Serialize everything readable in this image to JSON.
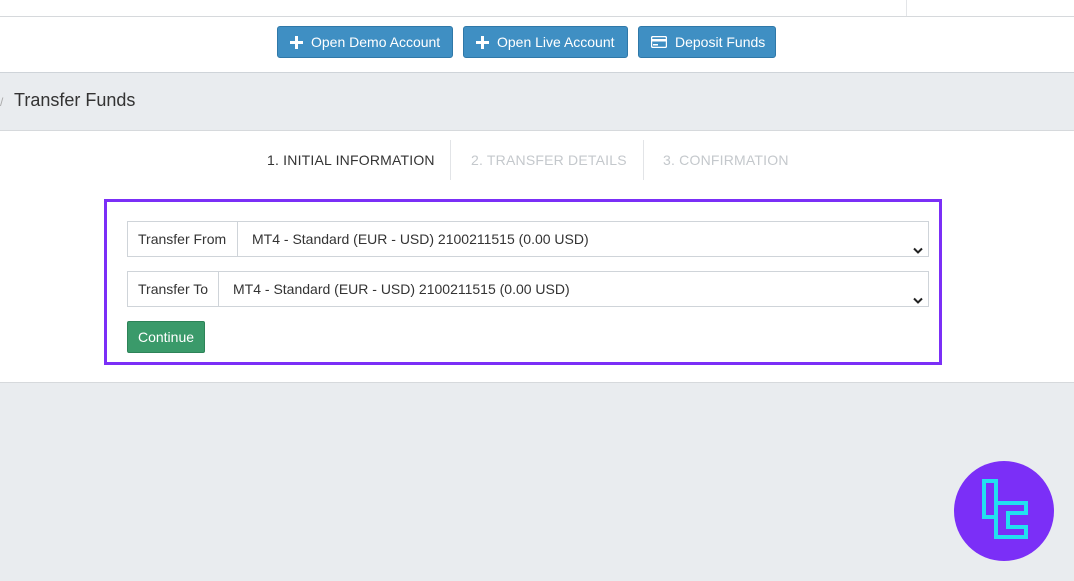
{
  "header_buttons": {
    "open_demo": "Open Demo Account",
    "open_live": "Open Live Account",
    "deposit": "Deposit Funds"
  },
  "breadcrumb": {
    "separator": "/"
  },
  "page": {
    "title": "Transfer Funds"
  },
  "steps": [
    {
      "label": "1. INITIAL INFORMATION",
      "state": "active"
    },
    {
      "label": "2. TRANSFER DETAILS",
      "state": "inactive"
    },
    {
      "label": "3. CONFIRMATION",
      "state": "inactive"
    }
  ],
  "form": {
    "transfer_from": {
      "label": "Transfer From",
      "value": "MT4 - Standard (EUR - USD) 2100211515 (0.00 USD)"
    },
    "transfer_to": {
      "label": "Transfer To",
      "value": "MT4 - Standard (EUR - USD) 2100211515 (0.00 USD)"
    },
    "continue_label": "Continue"
  },
  "colors": {
    "primary_button": "#3f8fc3",
    "success_button": "#3a9a6a",
    "highlight_border": "#7b2ff7",
    "logo_background": "#7b2ff7",
    "logo_mark": "#22e0f0"
  }
}
